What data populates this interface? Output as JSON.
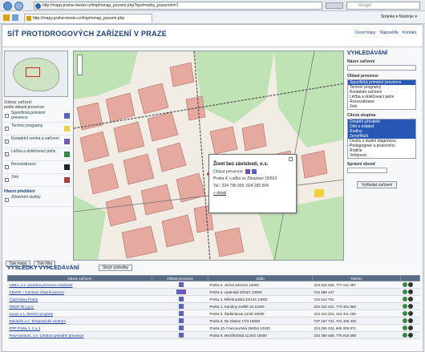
{
  "browser": {
    "url": "http://mapy.praha-mesto.cz/tmp/mmap_pozarni.php?spol=sinky_pozarnim=1",
    "tab_url": "http://mapy.praha-mesto.cz/tmp/mmap_pozarni.php",
    "search_placeholder": "Google",
    "toolbar_right": "Stránka ▾  Nástroje ▾"
  },
  "header": {
    "title": "SÍŤ PROTIDROGOVÝCH ZAŘÍZENÍ V PRAZE",
    "links": [
      "Úvod mapy",
      "Nápověda",
      "Kontakt"
    ]
  },
  "left_panel": {
    "section_label": "Zobraz zařízení",
    "section_sub": "podle oblasti prevence",
    "legend": [
      {
        "label": "Specifická primární prevence",
        "color": "#5b61c9"
      },
      {
        "label": "Terénní programy",
        "color": "#f2d23c"
      },
      {
        "label": "Kontaktní centra a zařízení",
        "color": "#7a55b8"
      },
      {
        "label": "Léčba a doléčovací péče",
        "color": "#2f8f3f"
      },
      {
        "label": "Resocializace",
        "color": "#222222"
      },
      {
        "label": "Jiné",
        "color": "#b23b3b"
      }
    ],
    "section2": "Hlavní předělení",
    "legend2": [
      {
        "label": "Zdravotní služby",
        "color": "#dddddd"
      }
    ],
    "buttons": [
      "Tisk mapy",
      "Tisk lištu"
    ]
  },
  "popup": {
    "title": "Život bez závislostí, o.s.",
    "line1": "Oblast prevence:",
    "line2": "Praha 4, Luďka ze Zbraslavi 15/603",
    "line3": "Tel.: 224 795 000, 604 289 504",
    "detail_link": "» detail"
  },
  "right_panel": {
    "title": "VYHLEDÁVÁNÍ",
    "name_label": "Název zařízení",
    "area_label": "Oblast prevence",
    "areas": [
      "Specifická primární prevence",
      "Terénní programy",
      "Kontaktní zařízení",
      "Léčba a doléčovací péče",
      "Resocializace",
      "Jiné"
    ],
    "target_label": "Cílová skupina",
    "targets": [
      "Dospělí uživatelé",
      "Děti a mládež",
      "Rodiny",
      "Ženy/Muži",
      "Osoby s duální diagnózou",
      "Pedagogové a pracovníci",
      "Rodiče",
      "Veřejnost"
    ],
    "district_label": "Správní obvod",
    "search_button": "Vyhledat zařízení"
  },
  "results": {
    "title": "VÝSLEDKY VYHLEDÁVÁNÍ",
    "toggle": "Skrýt výsledky",
    "columns": [
      "Název zařízení",
      "Oblast prevence",
      "Sídlo",
      "Telefon",
      ""
    ],
    "rows": [
      {
        "name": "ABBA, o.s. poradna prevence závislostí",
        "addr": "Praha 2, Ječná 33/1124 12000",
        "phone": "224 916 306, 777 112 387"
      },
      {
        "name": "CEVAP – Centrum včasné pomoci",
        "addr": "Praha 3, Lipanská 20/327 13000",
        "phone": "724 489 147"
      },
      {
        "name": "Čistá hlava Praha",
        "addr": "Praha 4, Bělehradská 34/124 14000",
        "phone": "734 544 704"
      },
      {
        "name": "DROP IN o.p.s.",
        "addr": "Praha 1, Karoliny Světlé 18 11000",
        "phone": "222 221 431, 773 401 560"
      },
      {
        "name": "Laxus o.s. Terénní program",
        "addr": "Praha 5, Štefánikova 12/46 15000",
        "phone": "224 313 321, 224 311 438"
      },
      {
        "name": "Sananim o.s. Terapeutické centrum",
        "addr": "Praha 5, Na Skalce 17/4 15000",
        "phone": "737 157 731, 721 425 325"
      },
      {
        "name": "PPP Praha 1, 2 a 4",
        "addr": "Praha 10, Francouzská 260/56 10100",
        "phone": "224 255 343, 606 205 871"
      },
      {
        "name": "Prev-centrum, o.s. Centrum primární prevence",
        "addr": "Praha 6, Meziškolská 1120/2 16000",
        "phone": "233 355 459, 776 016 586"
      }
    ]
  }
}
